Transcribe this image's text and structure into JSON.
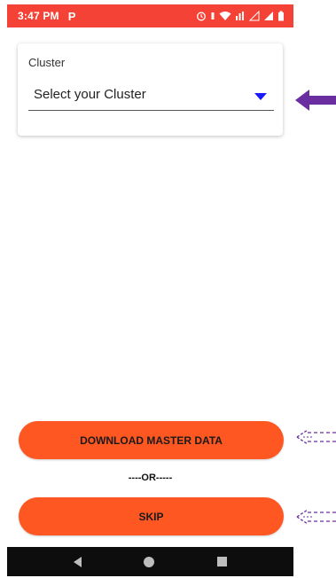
{
  "status_bar": {
    "time": "3:47 PM",
    "app_icon": "P",
    "icons": [
      "alarm-icon",
      "vibrate-icon",
      "wifi-icon",
      "signal-icon",
      "battery-icon"
    ]
  },
  "cluster_card": {
    "label": "Cluster",
    "select_value": "Select your Cluster"
  },
  "buttons": {
    "download_label": "DOWNLOAD MASTER DATA",
    "or_text": "----OR-----",
    "skip_label": "SKIP"
  },
  "colors": {
    "status_bar": "#f44336",
    "button": "#ff5722",
    "dropdown_arrow": "#1a1aff",
    "annotation_arrow": "#6a2ea0"
  }
}
